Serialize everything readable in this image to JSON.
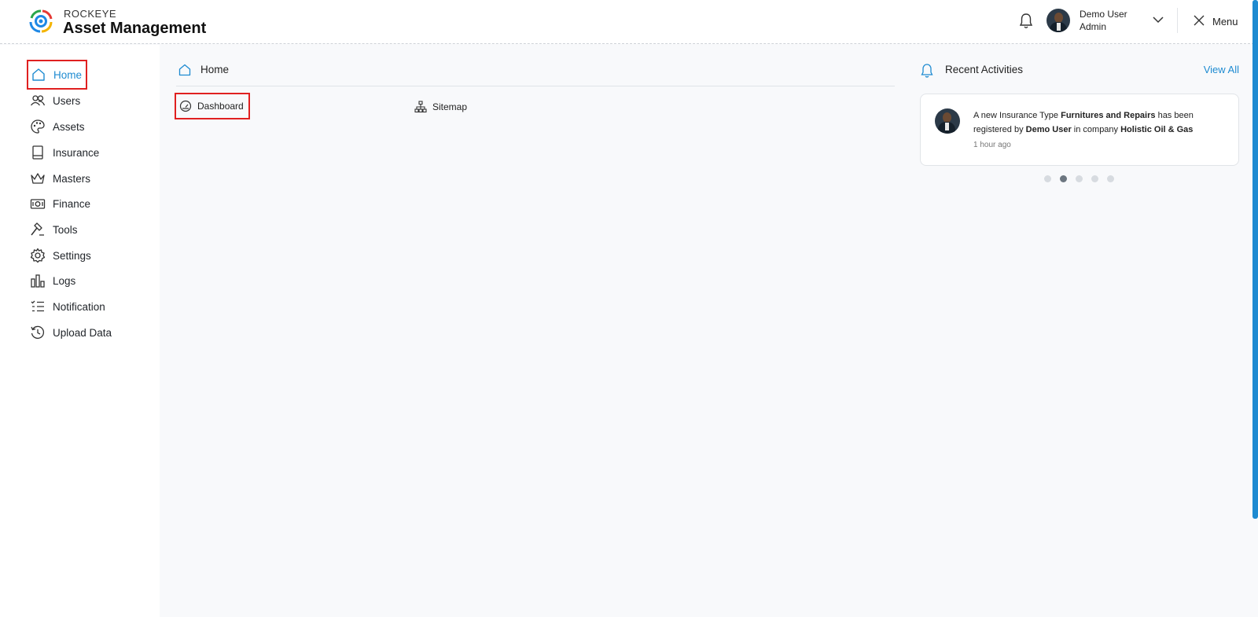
{
  "header": {
    "brand_top": "ROCKEYE",
    "brand_main": "Asset Management",
    "user_name": "Demo User",
    "user_role": "Admin",
    "menu_label": "Menu"
  },
  "sidebar": {
    "items": [
      {
        "label": "Home",
        "icon": "home-icon",
        "active": true
      },
      {
        "label": "Users",
        "icon": "users-icon"
      },
      {
        "label": "Assets",
        "icon": "palette-icon"
      },
      {
        "label": "Insurance",
        "icon": "book-icon"
      },
      {
        "label": "Masters",
        "icon": "crown-icon"
      },
      {
        "label": "Finance",
        "icon": "money-icon"
      },
      {
        "label": "Tools",
        "icon": "hammer-icon"
      },
      {
        "label": "Settings",
        "icon": "gear-icon"
      },
      {
        "label": "Logs",
        "icon": "bar-chart-icon"
      },
      {
        "label": "Notification",
        "icon": "checklist-icon"
      },
      {
        "label": "Upload Data",
        "icon": "history-icon"
      }
    ]
  },
  "main": {
    "title": "Home",
    "tiles": [
      {
        "label": "Dashboard",
        "icon": "gauge-icon"
      },
      {
        "label": "Sitemap",
        "icon": "sitemap-icon"
      }
    ]
  },
  "recent": {
    "title": "Recent Activities",
    "view_all": "View All",
    "activity": {
      "p1": "A new Insurance Type ",
      "b1": "Furnitures and Repairs",
      "p2": " has been registered by ",
      "b2": "Demo User",
      "p3": " in company ",
      "b3": "Holistic Oil & Gas",
      "time": "1 hour ago"
    },
    "carousel_active_index": 1,
    "carousel_count": 5
  },
  "colors": {
    "accent": "#1e8bd1",
    "highlight_box": "#e02020"
  }
}
